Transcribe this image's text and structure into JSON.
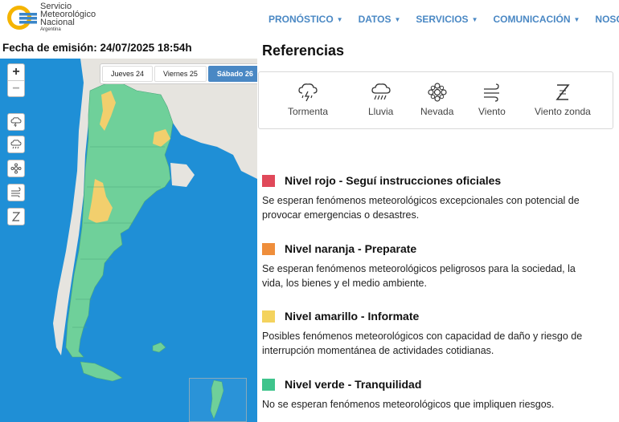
{
  "header": {
    "logo": {
      "line1": "Servicio",
      "line2": "Meteorológico",
      "line3": "Nacional",
      "line4": "Argentina"
    },
    "nav": [
      {
        "label": "PRONÓSTICO"
      },
      {
        "label": "DATOS"
      },
      {
        "label": "SERVICIOS"
      },
      {
        "label": "COMUNICACIÓN"
      },
      {
        "label": "NOSOTROS"
      }
    ]
  },
  "issued": "Fecha de emisión: 24/07/2025 18:54h",
  "map": {
    "zoom_in": "+",
    "zoom_out": "−",
    "day_tabs": [
      {
        "label": "Jueves 24",
        "active": false
      },
      {
        "label": "Viernes 25",
        "active": false
      },
      {
        "label": "Sábado 26",
        "active": true
      }
    ],
    "layer_icons": [
      "storm-icon",
      "rain-icon",
      "snow-icon",
      "wind-icon",
      "zonda-icon"
    ]
  },
  "references": {
    "title": "Referencias",
    "legend": [
      {
        "label": "Tormenta",
        "icon": "storm-icon"
      },
      {
        "label": "Lluvia",
        "icon": "rain-icon"
      },
      {
        "label": "Nevada",
        "icon": "snow-icon"
      },
      {
        "label": "Viento",
        "icon": "wind-icon"
      },
      {
        "label": "Viento zonda",
        "icon": "zonda-icon"
      }
    ],
    "levels": [
      {
        "color": "#e0495a",
        "title": "Nivel rojo - Seguí instrucciones oficiales",
        "desc": "Se esperan fenómenos meteorológicos excepcionales con potencial de provocar emergencias o desastres."
      },
      {
        "color": "#ef8e3b",
        "title": "Nivel naranja - Preparate",
        "desc": "Se esperan fenómenos meteorológicos peligrosos para la sociedad, la vida, los bienes y el medio ambiente."
      },
      {
        "color": "#f4d35e",
        "title": "Nivel amarillo - Informate",
        "desc": "Posibles fenómenos meteorológicos con capacidad de daño y riesgo de interrupción momentánea de actividades cotidianas."
      },
      {
        "color": "#3fc48c",
        "title": "Nivel verde - Tranquilidad",
        "desc": "No se esperan fenómenos meteorológicos que impliquen riesgos."
      }
    ]
  },
  "colors": {
    "nav": "#4a88c4",
    "sea": "#1f8fd6",
    "green": "#6fd09a",
    "yellow": "#f2cf6d"
  }
}
